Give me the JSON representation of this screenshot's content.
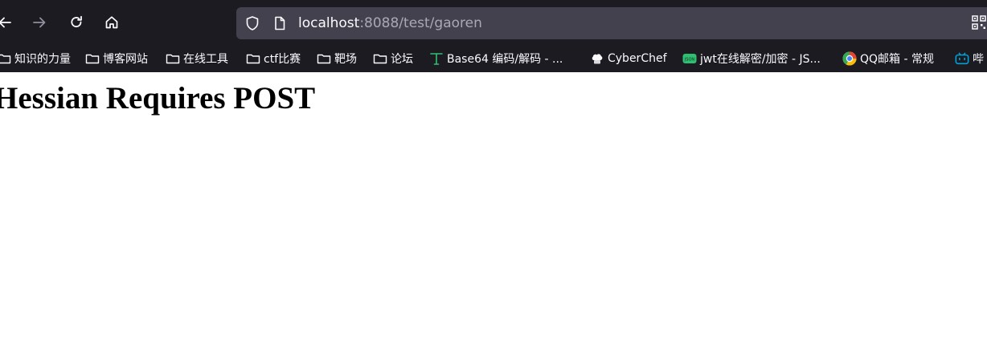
{
  "browser": {
    "url": {
      "host": "localhost",
      "rest": ":8088/test/gaoren"
    },
    "bookmarks": [
      {
        "label": "知识的力量",
        "icon": "folder-icon"
      },
      {
        "label": "博客网站",
        "icon": "folder-icon"
      },
      {
        "label": "在线工具",
        "icon": "folder-icon"
      },
      {
        "label": "ctf比赛",
        "icon": "folder-icon"
      },
      {
        "label": "靶场",
        "icon": "folder-icon"
      },
      {
        "label": "论坛",
        "icon": "folder-icon"
      },
      {
        "label": "Base64 编码/解码 - ...",
        "icon": "base64-site-icon"
      },
      {
        "label": "CyberChef",
        "icon": "chef-hat-icon"
      },
      {
        "label": "jwt在线解密/加密 - JS...",
        "icon": "json-icon",
        "icon_text": "JSON"
      },
      {
        "label": "QQ邮箱 - 常规",
        "icon": "qqmail-icon"
      },
      {
        "label": "哔",
        "icon": "bilibili-icon"
      }
    ]
  },
  "page": {
    "heading": "Hessian Requires POST"
  },
  "colors": {
    "chrome_bg": "#1c1b22",
    "urlbar_bg": "#42414d",
    "text_light": "#fbfbfe",
    "text_dim": "#a9a9b3",
    "bilibili_blue": "#00a1d6",
    "json_green": "#2fbf71"
  }
}
